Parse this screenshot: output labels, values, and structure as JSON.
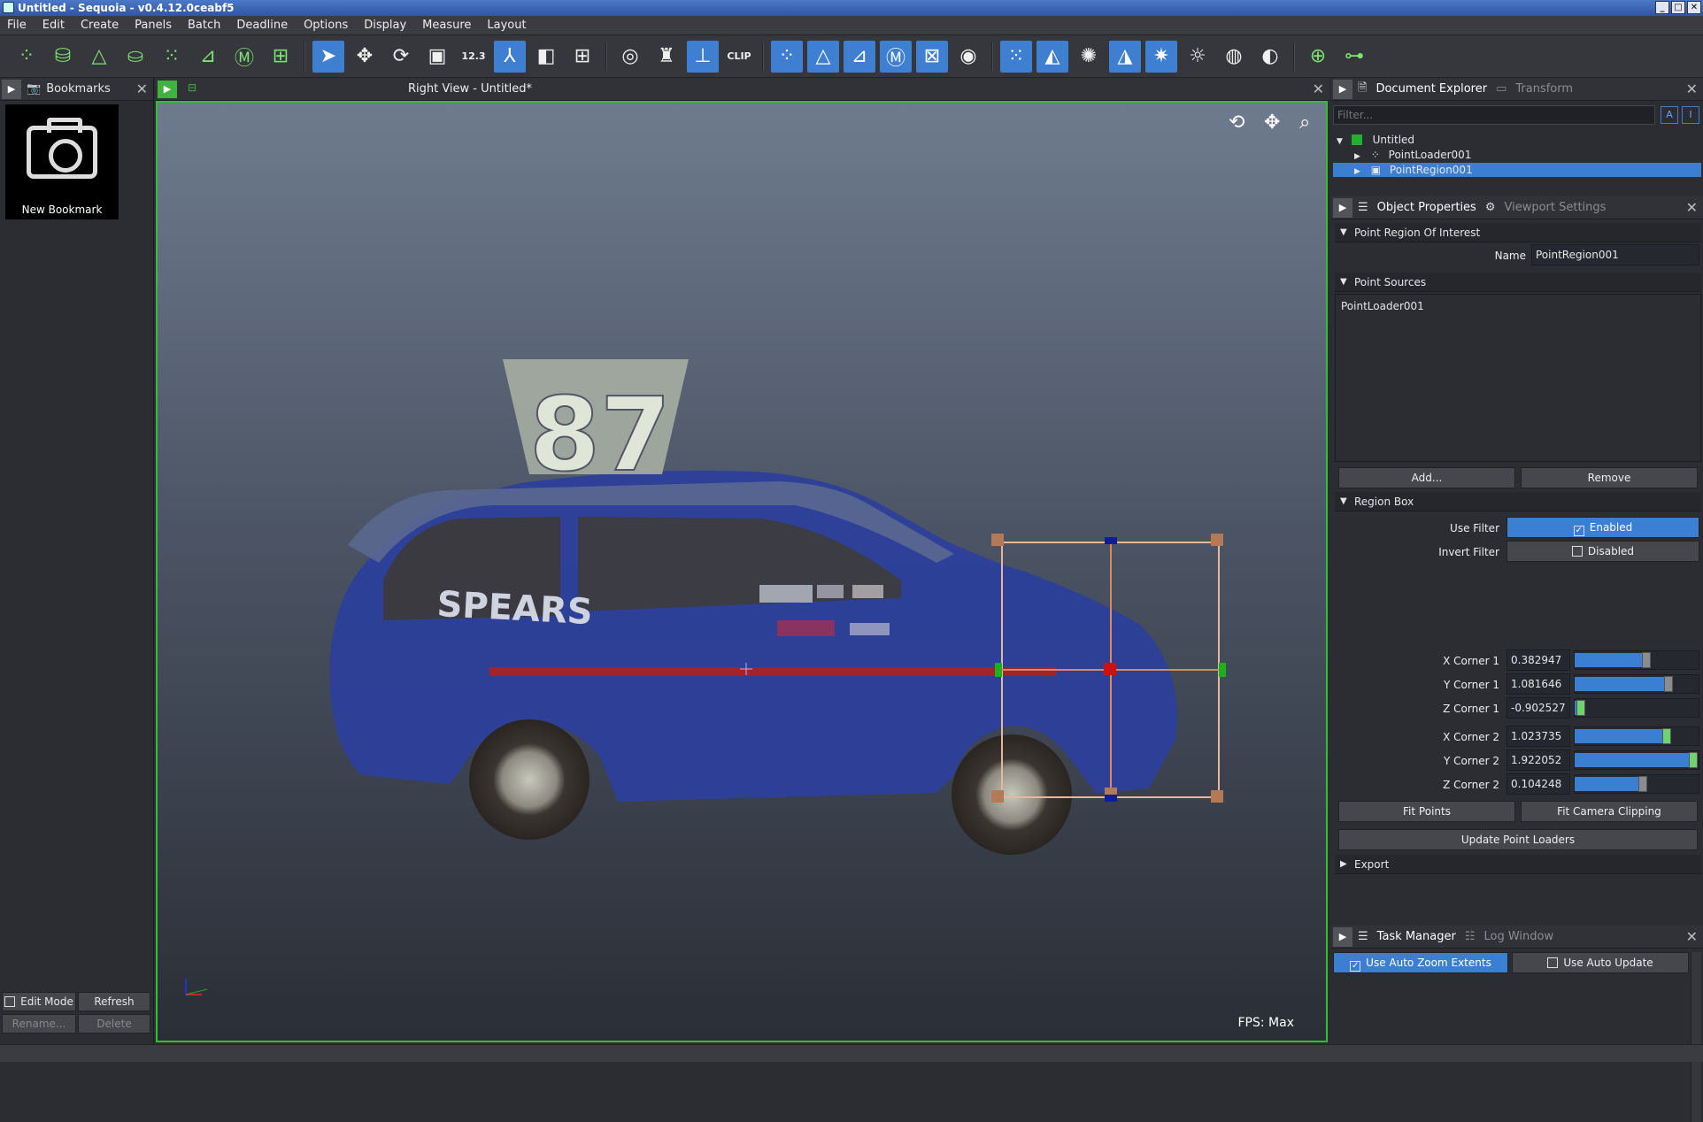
{
  "window": {
    "title": "Untitled - Sequoia - v0.4.12.0ceabf5"
  },
  "menu": [
    "File",
    "Edit",
    "Create",
    "Panels",
    "Batch",
    "Deadline",
    "Options",
    "Display",
    "Measure",
    "Layout"
  ],
  "toolbar": {
    "dimension_label": "12.3",
    "clip_label": "CLIP"
  },
  "bookmarks": {
    "tab": "Bookmarks",
    "item_label": "New Bookmark",
    "edit_mode": "Edit Mode",
    "refresh": "Refresh",
    "rename": "Rename...",
    "delete": "Delete"
  },
  "viewport": {
    "title": "Right View - Untitled*",
    "fps": "FPS:  Max",
    "car_number": "87",
    "car_text": "SPEARS"
  },
  "explorer": {
    "tab_active": "Document Explorer",
    "tab_inactive": "Transform",
    "filter_placeholder": "Filter...",
    "root": "Untitled",
    "items": [
      "PointLoader001",
      "PointRegion001"
    ]
  },
  "properties": {
    "tab_active": "Object Properties",
    "tab_inactive": "Viewport Settings",
    "section_roi": "Point Region Of Interest",
    "name_label": "Name",
    "name_value": "PointRegion001",
    "section_sources": "Point Sources",
    "source_item": "PointLoader001",
    "add": "Add...",
    "remove": "Remove",
    "section_box": "Region Box",
    "use_filter": "Use Filter",
    "use_filter_value": "Enabled",
    "invert_filter": "Invert Filter",
    "invert_filter_value": "Disabled",
    "corners": [
      {
        "label": "X Corner 1",
        "value": "0.382947",
        "level": 0.58
      },
      {
        "label": "Y Corner 1",
        "value": "1.081646",
        "level": 0.76
      },
      {
        "label": "Z Corner 1",
        "value": "-0.902527",
        "level": 0.05
      },
      {
        "label": "X Corner 2",
        "value": "1.023735",
        "level": 0.74
      },
      {
        "label": "Y Corner 2",
        "value": "1.922052",
        "level": 0.96
      },
      {
        "label": "Z Corner 2",
        "value": "0.104248",
        "level": 0.55
      }
    ],
    "fit_points": "Fit Points",
    "fit_camera": "Fit Camera Clipping",
    "update_loaders": "Update Point Loaders",
    "section_export": "Export"
  },
  "tasks": {
    "tab_active": "Task Manager",
    "tab_inactive": "Log Window",
    "auto_zoom": "Use Auto Zoom Extents",
    "auto_update": "Use Auto Update"
  },
  "colors": {
    "accent": "#3b7fd2",
    "viewport_border": "#2fc12f",
    "toolbar_icon": "#7de36f"
  }
}
